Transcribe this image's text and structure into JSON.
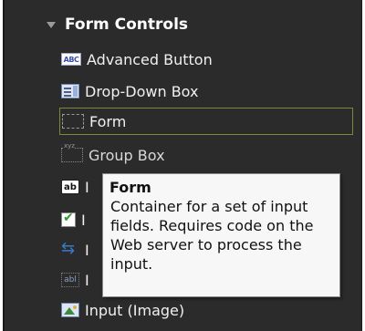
{
  "section": {
    "title": "Form Controls",
    "icon": "collapse-arrow-icon"
  },
  "items": [
    {
      "label": "Advanced Button",
      "icon": "abc-button-icon"
    },
    {
      "label": "Drop-Down Box",
      "icon": "dropdown-box-icon"
    },
    {
      "label": "Form",
      "icon": "form-icon",
      "selected": true
    },
    {
      "label": "Group Box",
      "icon": "group-box-icon"
    },
    {
      "label": "I",
      "icon": "text-input-icon"
    },
    {
      "label": "I",
      "icon": "checkbox-icon"
    },
    {
      "label": "I",
      "icon": "arrows-icon"
    },
    {
      "label": "I",
      "icon": "hidden-input-icon"
    },
    {
      "label": "Input (Image)",
      "icon": "image-input-icon"
    }
  ],
  "tooltip": {
    "title": "Form",
    "body": "Container for a set of input fields.  Requires code on the Web server to process the input."
  }
}
